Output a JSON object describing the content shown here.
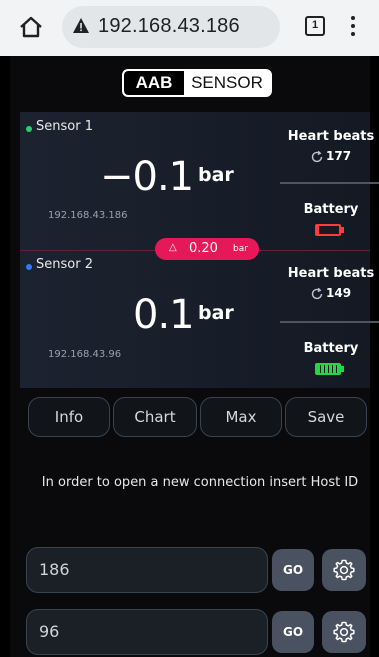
{
  "browser": {
    "url": "192.168.43.186",
    "tab_count": "1"
  },
  "logo": {
    "left": "AAB",
    "right": "SENSOR"
  },
  "sensors": [
    {
      "name": "Sensor 1",
      "value": "−0.1",
      "unit": "bar",
      "ip": "192.168.43.186",
      "heart_beats_label": "Heart beats",
      "heart_beats": "177",
      "battery_label": "Battery",
      "battery_level": 0.05,
      "battery_color": "#ff3b3b",
      "dot_color": "#2ecc71"
    },
    {
      "name": "Sensor 2",
      "value": "0.1",
      "unit": "bar",
      "ip": "192.168.43.96",
      "heart_beats_label": "Heart beats",
      "heart_beats": "149",
      "battery_label": "Battery",
      "battery_level": 1.0,
      "battery_color": "#27d645",
      "dot_color": "#2f7cf6"
    }
  ],
  "delta": {
    "symbol": "△",
    "value": "0.20",
    "unit": "bar"
  },
  "actions": {
    "info": "Info",
    "chart": "Chart",
    "max": "Max",
    "save": "Save"
  },
  "info_text": "In order to open a new connection insert Host ID",
  "connections": [
    {
      "host_id": "186",
      "go_label": "GO"
    },
    {
      "host_id": "96",
      "go_label": "GO"
    }
  ],
  "colors": {
    "accent_pink": "#e5195a",
    "panel_bg": "#1c2330",
    "button_bg": "#4a5160"
  }
}
